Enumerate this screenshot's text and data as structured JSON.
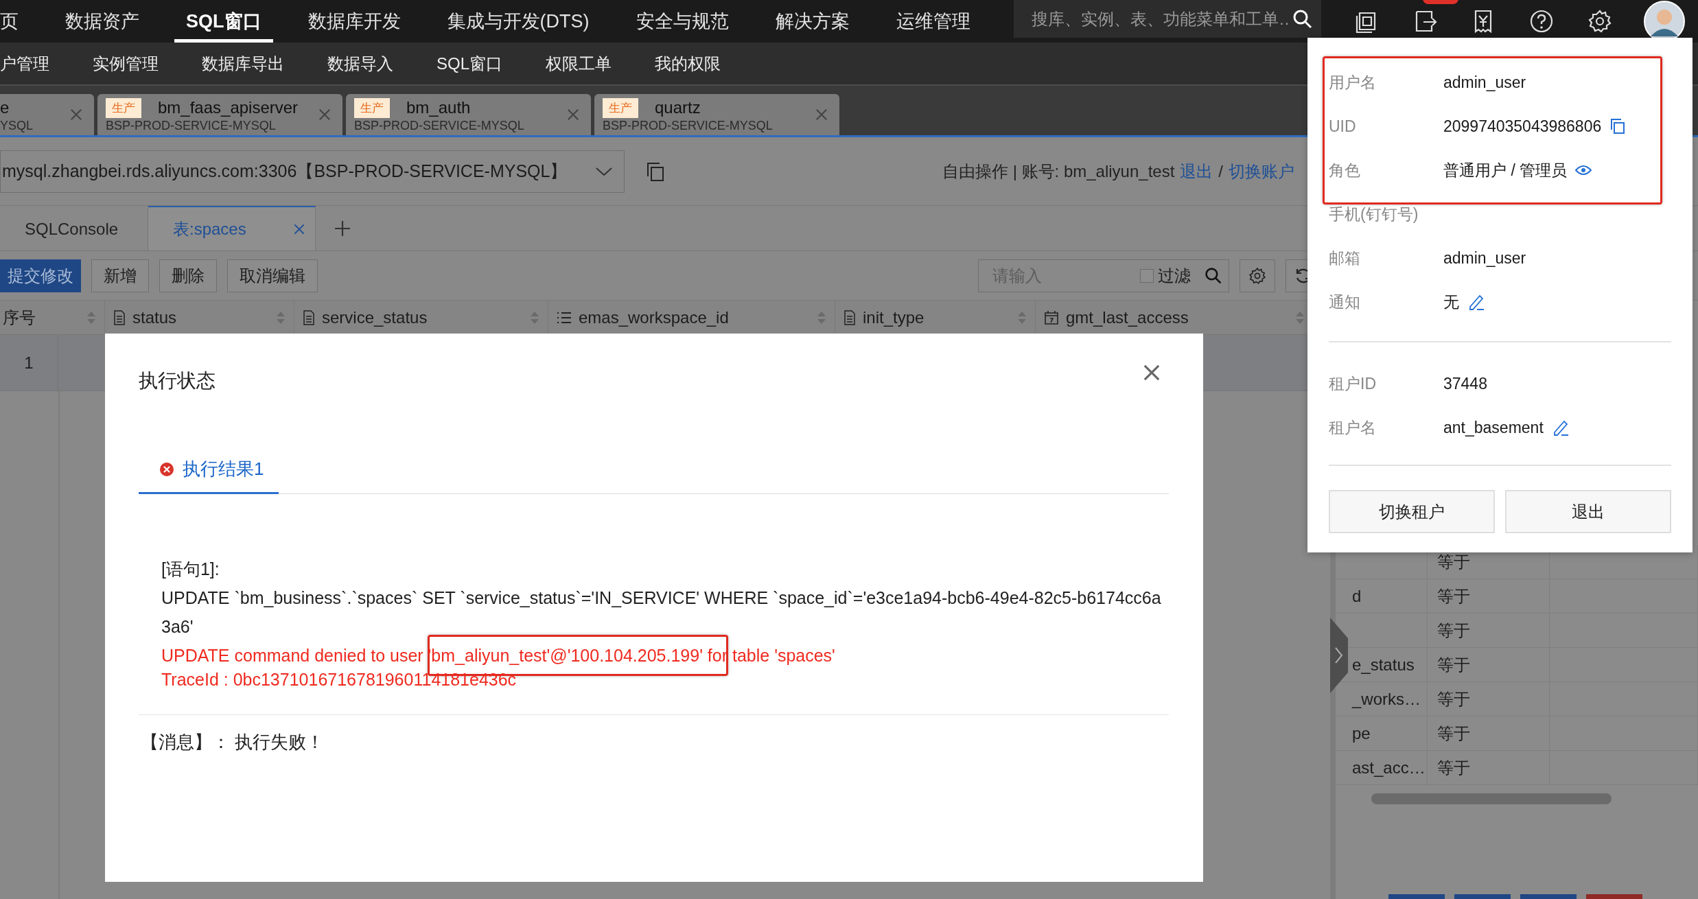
{
  "top_nav": {
    "items": [
      {
        "label": "页",
        "selected": false
      },
      {
        "label": "数据资产",
        "selected": false
      },
      {
        "label": "SQL窗口",
        "selected": true
      },
      {
        "label": "数据库开发",
        "selected": false
      },
      {
        "label": "集成与开发(DTS)",
        "selected": false
      },
      {
        "label": "安全与规范",
        "selected": false
      },
      {
        "label": "解决方案",
        "selected": false
      },
      {
        "label": "运维管理",
        "selected": false
      }
    ],
    "search": {
      "placeholder": "搜库、实例、表、功能菜单和工单…"
    }
  },
  "sub_nav": {
    "items": [
      "户管理",
      "实例管理",
      "数据库导出",
      "数据导入",
      "SQL窗口",
      "权限工单",
      "我的权限"
    ]
  },
  "instance_tabs": [
    {
      "title": "e",
      "subtitle": "YSQL"
    },
    {
      "tag": "生产",
      "title": "bm_faas_apiserver",
      "subtitle": "BSP-PROD-SERVICE-MYSQL"
    },
    {
      "tag": "生产",
      "title": "bm_auth",
      "subtitle": "BSP-PROD-SERVICE-MYSQL"
    },
    {
      "tag": "生产",
      "title": "quartz",
      "subtitle": "BSP-PROD-SERVICE-MYSQL"
    }
  ],
  "connection": {
    "value": "mysql.zhangbei.rds.aliyuncs.com:3306【BSP-PROD-SERVICE-MYSQL】",
    "account": "自由操作 | 账号: bm_aliyun_test",
    "links": [
      "退出",
      "切换账户"
    ],
    "separator": "/"
  },
  "sql_tabs": [
    {
      "label": "SQLConsole",
      "selected": false,
      "closable": false
    },
    {
      "label": "表:spaces",
      "selected": true,
      "closable": true
    }
  ],
  "toolbar": {
    "buttons": [
      {
        "label": "提交修改",
        "kind": "primary"
      },
      {
        "label": "新增",
        "kind": "default"
      },
      {
        "label": "删除",
        "kind": "default"
      },
      {
        "label": "取消编辑",
        "kind": "default"
      }
    ],
    "filter": {
      "placeholder": "请输入",
      "label": "过滤",
      "checked": false
    }
  },
  "table": {
    "columns": [
      {
        "label": "序号",
        "kind": "index"
      },
      {
        "label": "status",
        "kind": "text"
      },
      {
        "label": "service_status",
        "kind": "text"
      },
      {
        "label": "emas_workspace_id",
        "kind": "list"
      },
      {
        "label": "init_type",
        "kind": "text"
      },
      {
        "label": "gmt_last_access",
        "kind": "date"
      }
    ],
    "rows": [
      {
        "index": "1"
      }
    ]
  },
  "filter_panel": {
    "rows": [
      {
        "operator": "等于"
      },
      {
        "field": "d",
        "operator": "等于"
      },
      {
        "operator": "等于"
      },
      {
        "field": "e_status",
        "operator": "等于"
      },
      {
        "field": "_works…",
        "operator": "等于"
      },
      {
        "field": "pe",
        "operator": "等于"
      },
      {
        "field": "ast_acc…",
        "operator": "等于"
      }
    ]
  },
  "dialog": {
    "title": "执行状态",
    "tabs": [
      {
        "label": "执行结果1",
        "kind": "error",
        "selected": true
      }
    ],
    "statement": "[语句1]:",
    "sql": "UPDATE `bm_business`.`spaces` SET `service_status`='IN_SERVICE' WHERE `space_id`='e3ce1a94-bcb6-49e4-82c5-b6174cc6a3a6'",
    "errors": [
      "UPDATE command denied to user 'bm_aliyun_test'@'100.104.205.199' for table 'spaces'",
      "TraceId : 0bc1371016716781960114181e436c"
    ],
    "message": "【消息】： 执行失败！"
  },
  "user_menu": {
    "groups": [
      {
        "rows": [
          {
            "label": "用户名",
            "value": "admin_user",
            "kind": "plain"
          },
          {
            "label": "UID",
            "value": "209974035043986806",
            "kind": "copy"
          },
          {
            "label": "角色",
            "value": "普通用户 / 管理员",
            "kind": "view"
          },
          {
            "label": "手机(钉钉号)",
            "kind": "plain"
          },
          {
            "label": "邮箱",
            "value": "admin_user",
            "kind": "plain"
          },
          {
            "label": "通知",
            "value": "无",
            "kind": "edit"
          }
        ]
      },
      {
        "rows": [
          {
            "label": "租户ID",
            "value": "37448",
            "kind": "plain"
          },
          {
            "label": "租户名",
            "value": "ant_basement",
            "kind": "edit"
          }
        ]
      }
    ],
    "buttons": [
      "切换租户",
      "退出"
    ]
  }
}
